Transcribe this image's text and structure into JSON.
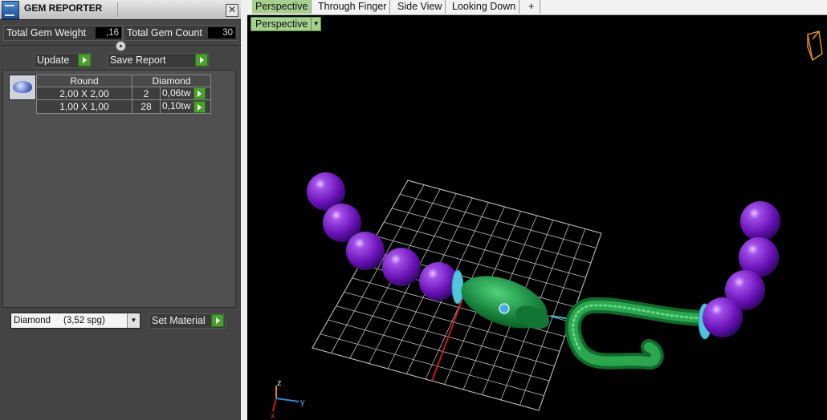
{
  "panel": {
    "title": "GEM REPORTER",
    "close_glyph": "✕",
    "total_weight_label": "Total Gem Weight",
    "total_weight_value": ",16",
    "total_count_label": "Total Gem Count",
    "total_count_value": "30",
    "update_label": "Update",
    "save_report_label": "Save Report",
    "table": {
      "headers": [
        "Round",
        "Diamond"
      ],
      "rows": [
        {
          "size": "2,00 X 2,00",
          "count": "2",
          "weight": "0,06tw"
        },
        {
          "size": "1,00 X 1,00",
          "count": "28",
          "weight": "0,10tw"
        }
      ]
    },
    "material_value": "Diamond     (3,52 spg)",
    "set_material_label": "Set Material"
  },
  "tabs": [
    {
      "label": "Perspective",
      "active": true
    },
    {
      "label": "Through Finger",
      "active": false
    },
    {
      "label": "Side View",
      "active": false
    },
    {
      "label": "Looking Down",
      "active": false
    },
    {
      "label": "+",
      "active": false
    }
  ],
  "viewport": {
    "view_dropdown": "Perspective",
    "axis_labels": {
      "z": "z",
      "y": "y",
      "x": "x"
    }
  },
  "colors": {
    "accent_green": "#a6d08f",
    "button_green": "#4aa02c",
    "bead_purple": "#7a1fc4",
    "snake_green": "#1f8a3c",
    "gem_cyan": "#5fd3e6",
    "grid": "#bfbfbf"
  }
}
